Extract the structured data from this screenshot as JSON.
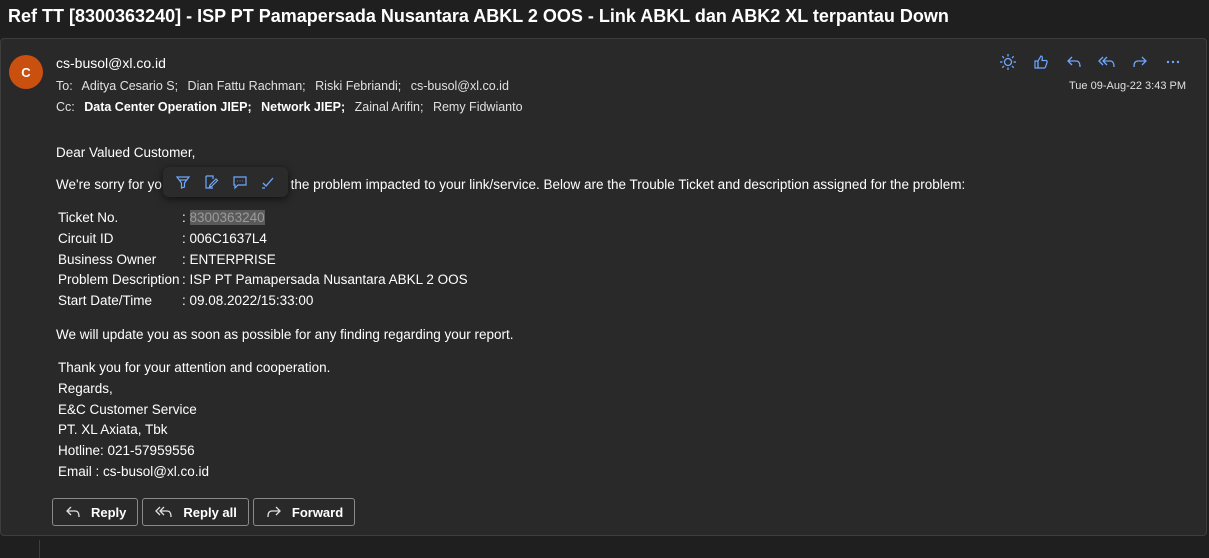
{
  "subject": "Ref TT [8300363240] - ISP PT Pamapersada Nusantara ABKL 2 OOS - Link ABKL dan ABK2 XL terpantau Down",
  "sender": {
    "initial": "C",
    "avatar_color": "#ca5010",
    "email": "cs-busol@xl.co.id"
  },
  "to": {
    "label": "To:",
    "recipients": [
      "Aditya Cesario S;",
      "Dian Fattu Rachman;",
      "Riski Febriandi;",
      "cs-busol@xl.co.id"
    ]
  },
  "cc": {
    "label": "Cc:",
    "recipients": [
      "Data Center Operation JIEP;",
      "Network JIEP;",
      "Zainal Arifin;",
      "Remy Fidwianto"
    ]
  },
  "date": "Tue 09-Aug-22 3:43 PM",
  "toolbar_icons": [
    "sun-icon",
    "like-icon",
    "reply-icon",
    "reply-all-icon",
    "forward-icon",
    "more-icon"
  ],
  "body": {
    "greeting": "Dear Valued Customer,",
    "intro_start": "We're sorry for yo",
    "intro_end": "d for the problem impacted to your link/service. Below are the Trouble Ticket and description assigned for the problem:",
    "ticket_rows": [
      {
        "key": "Ticket No.",
        "value": "8300363240"
      },
      {
        "key": "Circuit ID",
        "value": "006C1637L4"
      },
      {
        "key": "Business Owner",
        "value": "ENTERPRISE"
      },
      {
        "key": "Problem Description",
        "value": "ISP PT Pamapersada Nusantara ABKL 2 OOS"
      },
      {
        "key": "Start Date/Time",
        "value": "09.08.2022/15:33:00"
      }
    ],
    "update_line": "We will update you as soon as possible for any finding regarding your report.",
    "signature": [
      "Thank you for your attention and cooperation.",
      "Regards,",
      "E&C Customer Service",
      "PT. XL Axiata, Tbk",
      "Hotline: 021-57959556",
      "Email : cs-busol@xl.co.id"
    ]
  },
  "floating_toolbar_icons": [
    "highlight-icon",
    "note-icon",
    "comment-icon",
    "check-icon"
  ],
  "buttons": {
    "reply": "Reply",
    "reply_all": "Reply all",
    "forward": "Forward"
  }
}
